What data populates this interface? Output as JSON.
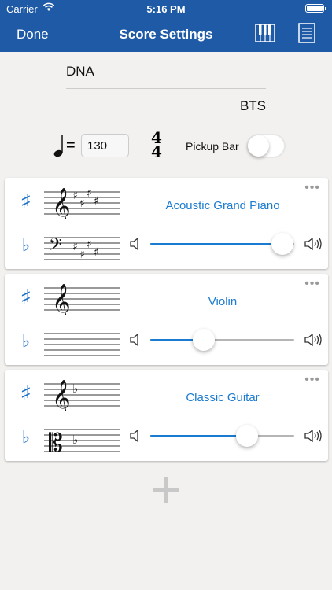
{
  "status": {
    "carrier": "Carrier",
    "time": "5:16 PM"
  },
  "nav": {
    "done_label": "Done",
    "title": "Score Settings",
    "piano_icon": "piano-keys-icon",
    "doc_icon": "document-icon"
  },
  "score": {
    "title": "DNA",
    "composer": "BTS"
  },
  "tempo": {
    "bpm": "130",
    "eq": "=",
    "time_sig_top": "4",
    "time_sig_bottom": "4"
  },
  "pickup": {
    "label": "Pickup Bar",
    "on": false
  },
  "symbols": {
    "sharp": "♯",
    "flat": "♭",
    "more": "•••"
  },
  "instruments": [
    {
      "name": "Acoustic Grand Piano",
      "top_clef": "treble",
      "top_key": "4 sharps",
      "bottom_clef": "bass",
      "bottom_key": "4 sharps",
      "volume": 0.92
    },
    {
      "name": "Violin",
      "top_clef": "treble",
      "top_key": "none",
      "bottom_clef": "none",
      "bottom_key": "none",
      "volume": 0.37
    },
    {
      "name": "Classic Guitar",
      "top_clef": "treble",
      "top_key": "1 flat",
      "bottom_clef": "alto",
      "bottom_key": "1 flat",
      "volume": 0.67
    }
  ],
  "add_button_icon": "plus-icon",
  "colors": {
    "nav_bg": "#1f5aa6",
    "accent": "#1a7bd1",
    "background": "#f2f1ef"
  }
}
